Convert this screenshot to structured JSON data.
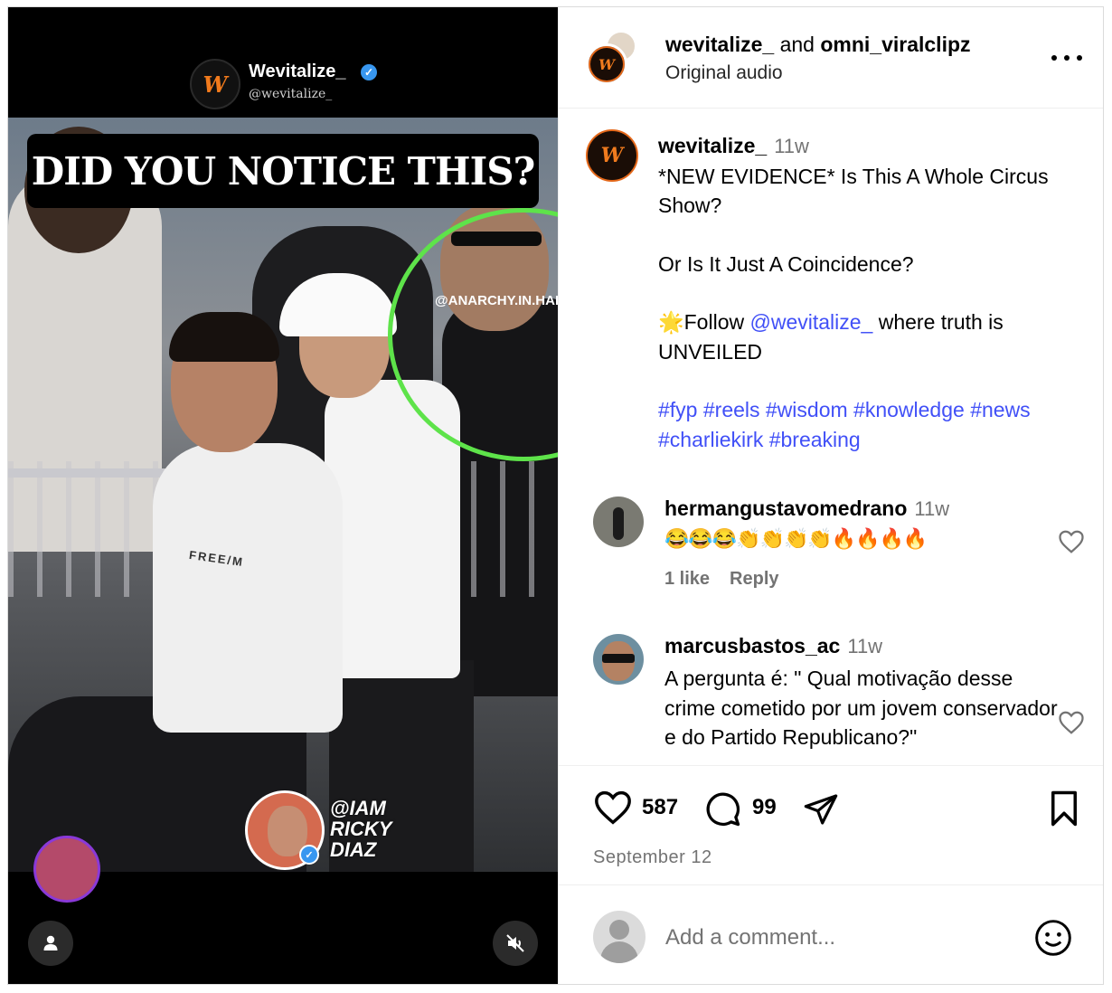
{
  "video": {
    "brand_name": "Wevitalize_",
    "brand_handle": "@wevitalize_",
    "logo_text": "W",
    "headline": "DID YOU NOTICE THIS?",
    "watermark": "@ANARCHY.IN.HARM",
    "shirt_text": "FREE/M",
    "overlay_label": [
      "@IAM",
      "RICKY",
      "DIAZ"
    ]
  },
  "post": {
    "header": {
      "author": "wevitalize_",
      "connector": "and",
      "collaborator": "omni_viralclipz",
      "audio": "Original audio"
    },
    "caption": {
      "username": "wevitalize_",
      "time": "11w",
      "line1": "*NEW EVIDENCE* Is This A Whole Circus Show?",
      "line2": "Or Is It Just A Coincidence?",
      "follow_prefix": "🌟Follow ",
      "follow_link": "@wevitalize_",
      "follow_suffix": " where truth is UNVEILED",
      "hashtags": "#fyp #reels #wisdom #knowledge #news #charliekirk #breaking"
    },
    "comments": [
      {
        "username": "hermangustavomedrano",
        "time": "11w",
        "text": "😂😂😂👏👏👏👏🔥🔥🔥🔥",
        "likes": "1 like",
        "reply": "Reply"
      },
      {
        "username": "marcusbastos_ac",
        "time": "11w",
        "text": "A pergunta é: \" Qual motivação desse crime cometido por um jovem conservador e do Partido Republicano?\""
      }
    ],
    "like_count": "587",
    "comment_count": "99",
    "date": "September 12",
    "add_comment_placeholder": "Add a comment..."
  },
  "icons": {
    "more": "more-icon",
    "like": "heart-icon",
    "comment": "comment-icon",
    "share": "share-icon",
    "save": "bookmark-icon",
    "emoji": "emoji-icon",
    "user_tag": "user-icon",
    "mute": "muted-speaker-icon"
  },
  "colors": {
    "link": "#4150f7",
    "secondary_text": "#737373",
    "brand_orange": "#f07b1e",
    "highlight_circle": "#5ee34a"
  }
}
